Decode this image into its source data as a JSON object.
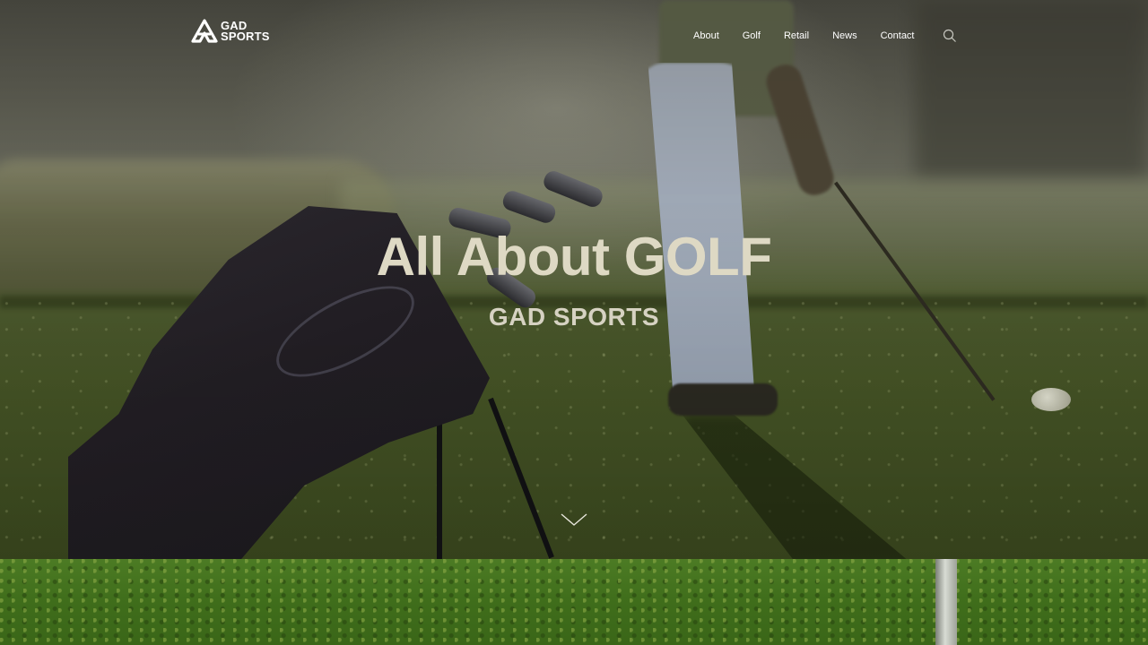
{
  "brand": {
    "line1": "GAD",
    "line2": "SPORTS",
    "logo_icon": "gad-logo-icon"
  },
  "nav": {
    "items": [
      {
        "label": "About"
      },
      {
        "label": "Golf"
      },
      {
        "label": "Retail"
      },
      {
        "label": "News"
      },
      {
        "label": "Contact"
      }
    ],
    "search_icon": "search-icon"
  },
  "hero": {
    "title": "All About GOLF",
    "subtitle": "GAD SPORTS",
    "scroll_icon": "chevron-down-icon"
  },
  "colors": {
    "hero_title": "#ded9c4",
    "nav_text": "#ffffff",
    "grass": "#3f6d1b"
  }
}
